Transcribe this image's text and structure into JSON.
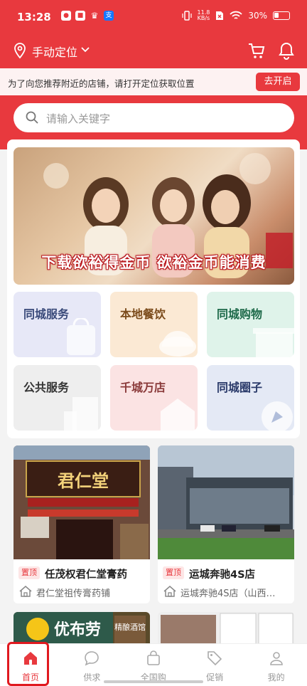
{
  "status_bar": {
    "time": "13:28",
    "net_speed_value": "11.8",
    "net_speed_unit": "KB/s",
    "battery": "30%"
  },
  "header": {
    "location_label": "手动定位"
  },
  "location_banner": {
    "message": "为了向您推荐附近的店铺，请打开定位获取位置",
    "button_label": "去开启"
  },
  "search": {
    "placeholder": "请输入关键字"
  },
  "banner": {
    "text": "下载欲裕得金币 欲裕金币能消费"
  },
  "categories": [
    {
      "label": "同城服务",
      "color": "#3a4a7a",
      "bg": "#e7e8f7"
    },
    {
      "label": "本地餐饮",
      "color": "#7a4a1a",
      "bg": "#fbe9d4"
    },
    {
      "label": "同城购物",
      "color": "#1e6a4a",
      "bg": "#dff3ea"
    },
    {
      "label": "公共服务",
      "color": "#333333",
      "bg": "#eeeeee"
    },
    {
      "label": "千城万店",
      "color": "#8a3a3a",
      "bg": "#fbe3e3"
    },
    {
      "label": "同城圈子",
      "color": "#2a3a6a",
      "bg": "#e4e9f5"
    }
  ],
  "stores": [
    {
      "tag": "置顶",
      "title": "任茂权君仁堂膏药",
      "subtitle": "君仁堂祖传膏药铺",
      "sign": "君仁堂"
    },
    {
      "tag": "置顶",
      "title": "运城奔驰4S店",
      "subtitle": "运城奔驰4S店（山西…"
    }
  ],
  "partial_stores": [
    {
      "sign": "优布劳",
      "side": "精酿酒馆"
    }
  ],
  "nav": [
    {
      "label": "首页",
      "icon": "home-icon",
      "active": true
    },
    {
      "label": "供求",
      "icon": "chat-icon",
      "active": false
    },
    {
      "label": "全国购",
      "icon": "bag-icon",
      "active": false
    },
    {
      "label": "促销",
      "icon": "tag-icon",
      "active": false
    },
    {
      "label": "我的",
      "icon": "user-icon",
      "active": false
    }
  ],
  "colors": {
    "brand_red": "#e8393e"
  }
}
